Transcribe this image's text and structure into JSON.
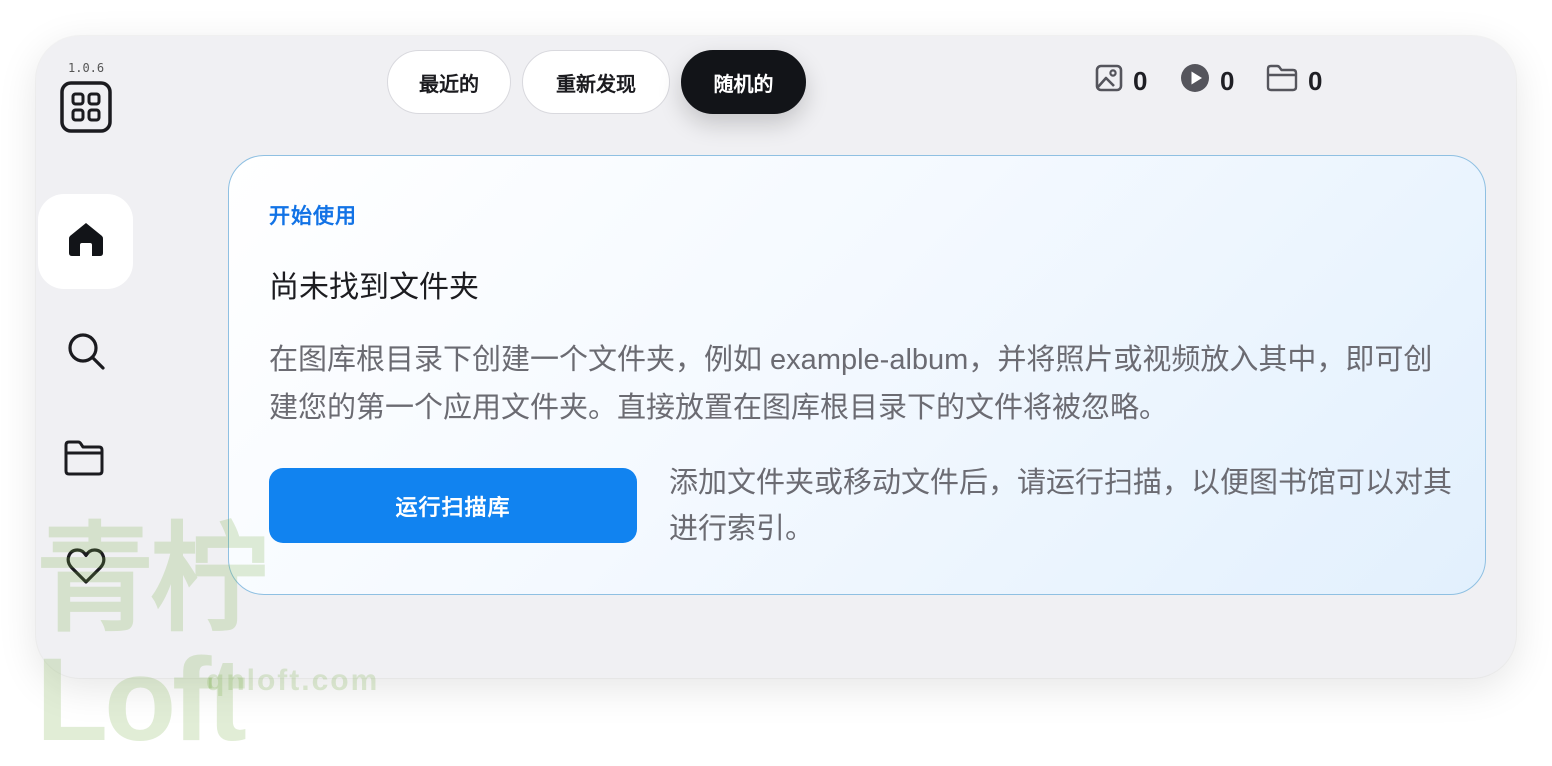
{
  "app": {
    "version": "1.0.6"
  },
  "tabs": [
    {
      "label": "最近的",
      "active": false
    },
    {
      "label": "重新发现",
      "active": false
    },
    {
      "label": "随机的",
      "active": true
    }
  ],
  "stats": {
    "images": "0",
    "videos": "0",
    "folders": "0"
  },
  "sidebar": {
    "items": [
      {
        "icon": "home-icon",
        "active": true
      },
      {
        "icon": "search-icon",
        "active": false
      },
      {
        "icon": "folder-icon",
        "active": false
      },
      {
        "icon": "heart-icon",
        "active": false
      }
    ]
  },
  "card": {
    "eyebrow": "开始使用",
    "title": "尚未找到文件夹",
    "description": "在图库根目录下创建一个文件夹，例如 example-album，并将照片或视频放入其中，即可创建您的第一个应用文件夹。直接放置在图库根目录下的文件将被忽略。",
    "scan_button": "运行扫描库",
    "scan_hint": "添加文件夹或移动文件后，请运行扫描，以便图书馆可以对其进行索引。"
  },
  "watermark": {
    "title": "青柠Loft",
    "url": "qnloft.com"
  },
  "colors": {
    "accent": "#1183f0",
    "eyebrow": "#1273e6",
    "active_tab": "#121418",
    "card_border": "#8fc0e2"
  }
}
